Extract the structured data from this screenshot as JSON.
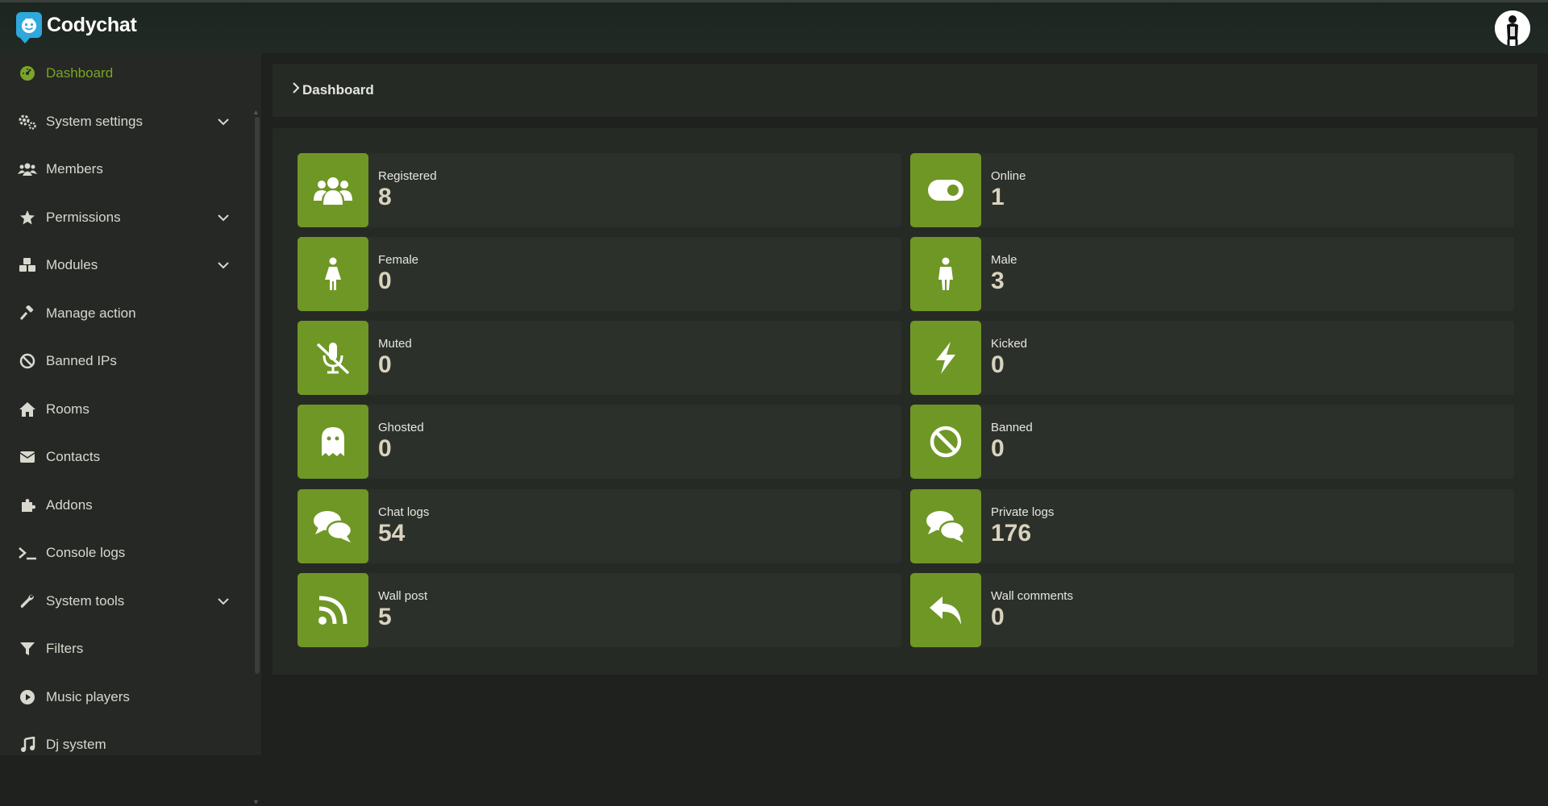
{
  "app": {
    "name": "Codychat"
  },
  "sidebar": {
    "items": [
      {
        "label": "Dashboard",
        "icon": "dashboard-icon",
        "active": true
      },
      {
        "label": "System settings",
        "icon": "cogs-icon",
        "expandable": true
      },
      {
        "label": "Members",
        "icon": "users-icon"
      },
      {
        "label": "Permissions",
        "icon": "star-icon",
        "expandable": true
      },
      {
        "label": "Modules",
        "icon": "cubes-icon",
        "expandable": true
      },
      {
        "label": "Manage action",
        "icon": "gavel-icon"
      },
      {
        "label": "Banned IPs",
        "icon": "ban-icon"
      },
      {
        "label": "Rooms",
        "icon": "home-icon"
      },
      {
        "label": "Contacts",
        "icon": "envelope-icon"
      },
      {
        "label": "Addons",
        "icon": "puzzle-icon"
      },
      {
        "label": "Console logs",
        "icon": "terminal-icon"
      },
      {
        "label": "System tools",
        "icon": "wrench-icon",
        "expandable": true
      },
      {
        "label": "Filters",
        "icon": "filter-icon"
      },
      {
        "label": "Music players",
        "icon": "play-circle-icon"
      },
      {
        "label": "Dj system",
        "icon": "music-icon"
      }
    ]
  },
  "breadcrumb": {
    "label": "Dashboard"
  },
  "stats": [
    {
      "title": "Registered",
      "value": "8",
      "icon": "users-icon"
    },
    {
      "title": "Online",
      "value": "1",
      "icon": "toggle-on-icon"
    },
    {
      "title": "Female",
      "value": "0",
      "icon": "female-icon"
    },
    {
      "title": "Male",
      "value": "3",
      "icon": "male-icon"
    },
    {
      "title": "Muted",
      "value": "0",
      "icon": "microphone-slash-icon"
    },
    {
      "title": "Kicked",
      "value": "0",
      "icon": "bolt-icon"
    },
    {
      "title": "Ghosted",
      "value": "0",
      "icon": "ghost-icon"
    },
    {
      "title": "Banned",
      "value": "0",
      "icon": "ban-icon"
    },
    {
      "title": "Chat logs",
      "value": "54",
      "icon": "comments-icon"
    },
    {
      "title": "Private logs",
      "value": "176",
      "icon": "comments-icon"
    },
    {
      "title": "Wall post",
      "value": "5",
      "icon": "rss-icon"
    },
    {
      "title": "Wall comments",
      "value": "0",
      "icon": "reply-icon"
    }
  ],
  "colors": {
    "accent": "#6f9725",
    "active_text": "#79a527",
    "background": "#1e211d",
    "panel": "#262a25"
  }
}
